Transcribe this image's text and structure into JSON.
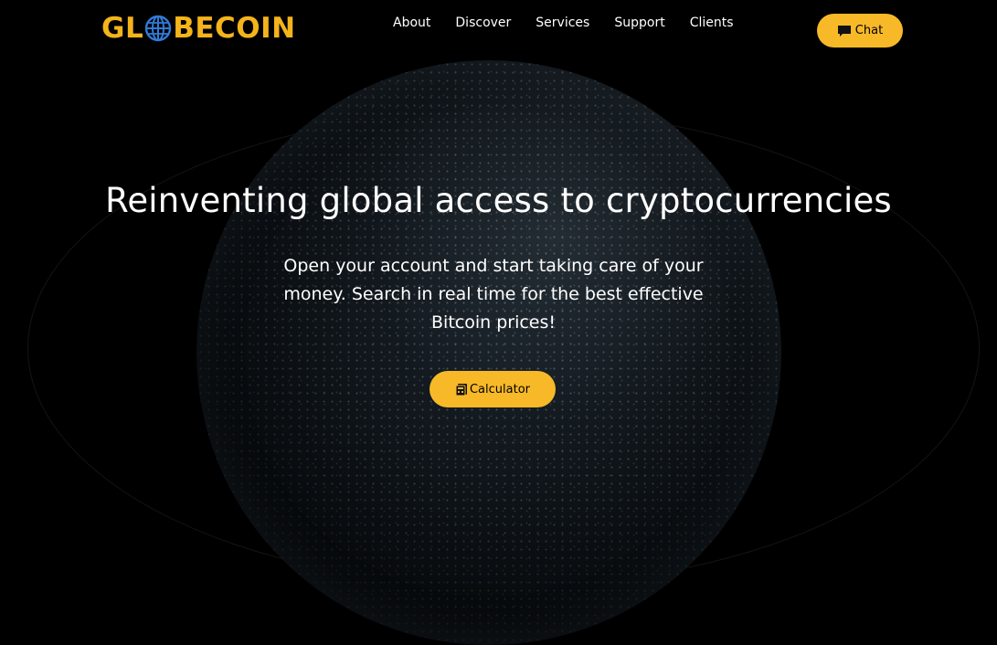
{
  "brand": {
    "logo_left": "GL",
    "logo_right": "BECOIN",
    "accent_color": "#f7b928"
  },
  "nav": {
    "items": [
      {
        "label": "About"
      },
      {
        "label": "Discover"
      },
      {
        "label": "Services"
      },
      {
        "label": "Support"
      },
      {
        "label": "Clients"
      }
    ]
  },
  "header": {
    "chat_label": "Chat",
    "chat_icon": "chat-bubble-icon"
  },
  "hero": {
    "title": "Reinventing global access to cryptocurrencies",
    "subtitle": "Open your account and start taking care of your money. Search in real time for the best effective Bitcoin prices!",
    "calculator_label": "Calculator",
    "calculator_icon": "calculator-icon"
  }
}
